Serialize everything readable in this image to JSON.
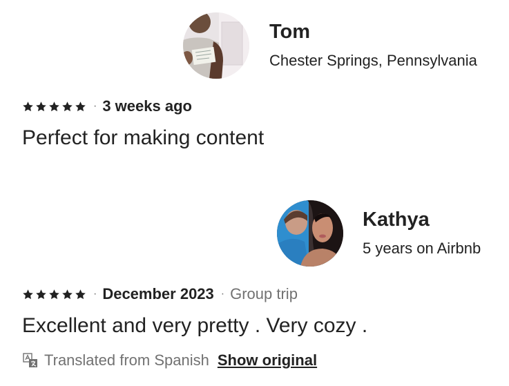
{
  "reviews": [
    {
      "name": "Tom",
      "subtitle": "Chester Springs, Pennsylvania",
      "rating": 5,
      "date": "3 weeks ago",
      "text": "Perfect for making content"
    },
    {
      "name": "Kathya",
      "subtitle": "5 years on Airbnb",
      "rating": 5,
      "date": "December 2023",
      "trip_type": "Group trip",
      "text": "Excellent and very pretty . Very cozy .",
      "translation_note": "Translated from Spanish",
      "show_original_label": "Show original"
    }
  ],
  "separator": "·",
  "icons": {
    "star": "star-icon",
    "translate": "translate-icon"
  },
  "colors": {
    "text_primary": "#222222",
    "text_secondary": "#717171"
  }
}
